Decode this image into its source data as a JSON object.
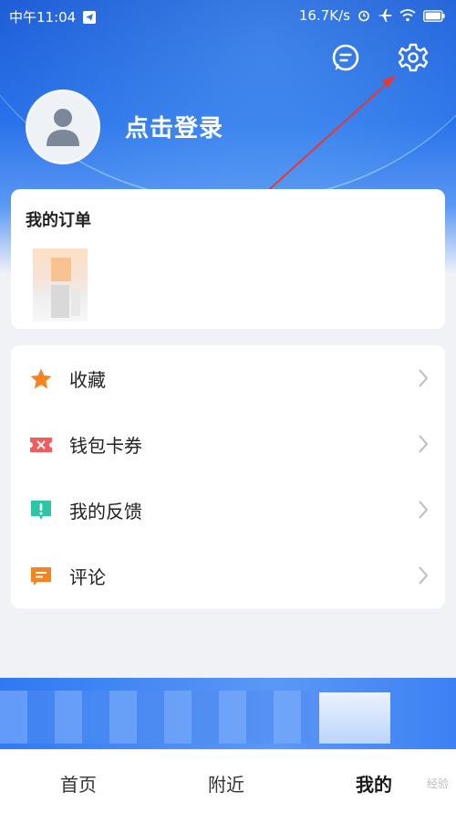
{
  "status_bar": {
    "time": "中午11:04",
    "network_speed": "16.7K/s"
  },
  "header": {
    "login_label": "点击登录",
    "icons": [
      "message-icon",
      "settings-gear-icon"
    ]
  },
  "orders": {
    "title": "我的订单"
  },
  "menu": {
    "items": [
      {
        "label": "收藏",
        "icon": "star-icon",
        "color": "#f5841f"
      },
      {
        "label": "钱包卡券",
        "icon": "ticket-icon",
        "color": "#f25c5c"
      },
      {
        "label": "我的反馈",
        "icon": "feedback-icon",
        "color": "#2ec4a6"
      },
      {
        "label": "评论",
        "icon": "comment-icon",
        "color": "#f5841f"
      }
    ]
  },
  "bottom_nav": {
    "tabs": [
      {
        "label": "首页",
        "active": false
      },
      {
        "label": "附近",
        "active": false
      },
      {
        "label": "我的",
        "active": true
      }
    ],
    "watermark": "经验"
  },
  "colors": {
    "header_blue": "#2a73ea",
    "page_bg": "#f1f2f6",
    "arrow_red": "#e53935"
  }
}
